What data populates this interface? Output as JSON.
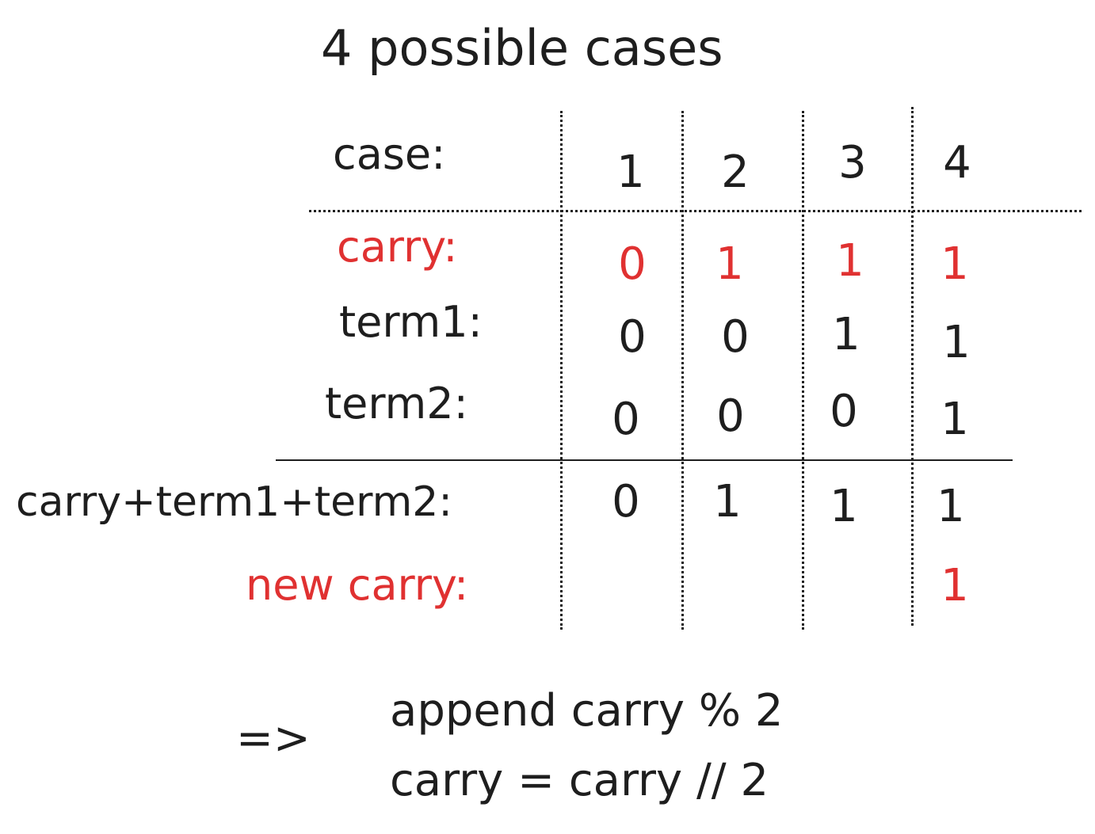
{
  "title": "4 possible cases",
  "rows": {
    "case": {
      "label": "case:",
      "values": [
        "1",
        "2",
        "3",
        "4"
      ]
    },
    "carry": {
      "label": "carry:",
      "values": [
        "0",
        "1",
        "1",
        "1"
      ]
    },
    "term1": {
      "label": "term1:",
      "values": [
        "0",
        "0",
        "1",
        "1"
      ]
    },
    "term2": {
      "label": "term2:",
      "values": [
        "0",
        "0",
        "0",
        "1"
      ]
    },
    "sum": {
      "label": "carry+term1+term2:",
      "values": [
        "0",
        "1",
        "1",
        "1"
      ]
    },
    "new_carry": {
      "label": "new carry:",
      "values": [
        "",
        "",
        "",
        "1"
      ]
    }
  },
  "conclusion": {
    "arrow": "=>",
    "line1": "append carry % 2",
    "line2": "carry = carry // 2"
  },
  "colors": {
    "text": "#1e1e1e",
    "highlight": "#e03131"
  }
}
